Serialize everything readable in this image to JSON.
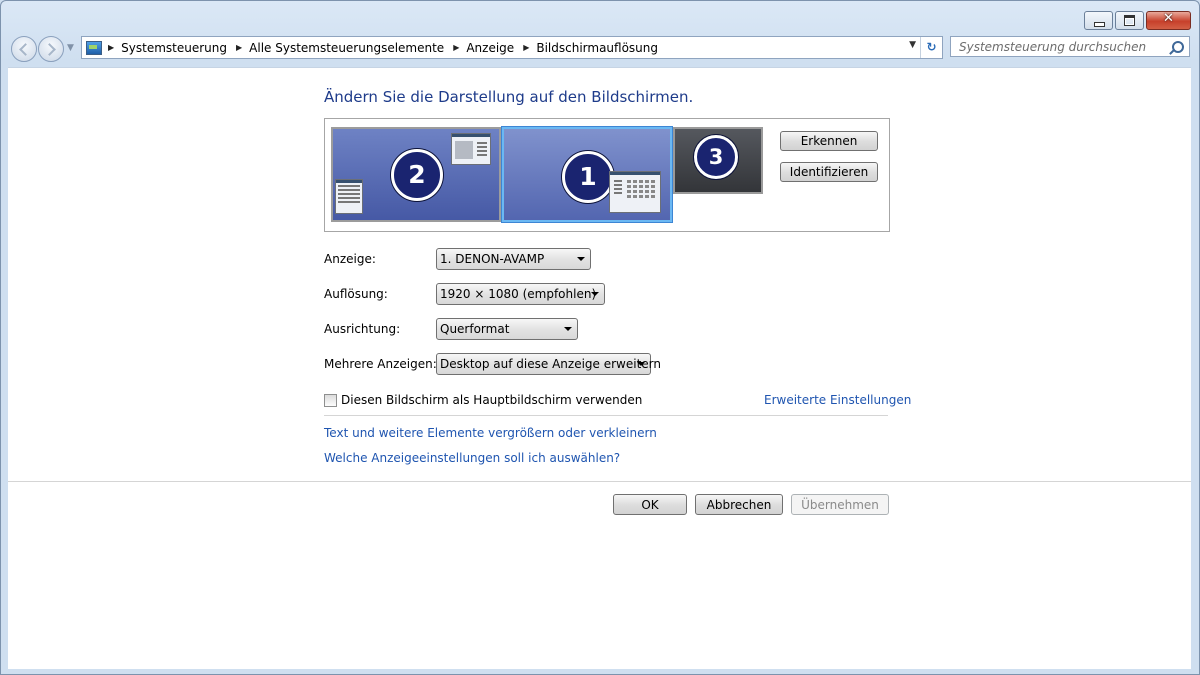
{
  "window": {
    "caption_buttons": {
      "minimize": "minimize",
      "maximize": "maximize",
      "close": "✕"
    }
  },
  "nav": {
    "breadcrumbs": [
      "Systemsteuerung",
      "Alle Systemsteuerungselemente",
      "Anzeige",
      "Bildschirmauflösung"
    ],
    "search_placeholder": "Systemsteuerung durchsuchen"
  },
  "main": {
    "title": "Ändern Sie die Darstellung auf den Bildschirmen.",
    "monitors": [
      {
        "number": "2",
        "state": "normal"
      },
      {
        "number": "1",
        "state": "selected"
      },
      {
        "number": "3",
        "state": "disabled"
      }
    ],
    "detect_label": "Erkennen",
    "identify_label": "Identifizieren",
    "settings": {
      "display": {
        "label": "Anzeige:",
        "value": "1. DENON-AVAMP"
      },
      "resolution": {
        "label": "Auflösung:",
        "value": "1920 × 1080 (empfohlen)"
      },
      "orientation": {
        "label": "Ausrichtung:",
        "value": "Querformat"
      },
      "multiple": {
        "label": "Mehrere Anzeigen:",
        "value": "Desktop auf diese Anzeige erweitern"
      }
    },
    "primary_checkbox": {
      "label": "Diesen Bildschirm als Hauptbildschirm verwenden",
      "checked": false
    },
    "advanced_link": "Erweiterte Einstellungen",
    "text_size_link": "Text und weitere Elemente vergrößern oder verkleinern",
    "which_settings_link": "Welche Anzeigeeinstellungen soll ich auswählen?"
  },
  "dialog": {
    "ok": "OK",
    "cancel": "Abbrechen",
    "apply": "Übernehmen",
    "apply_enabled": false
  }
}
